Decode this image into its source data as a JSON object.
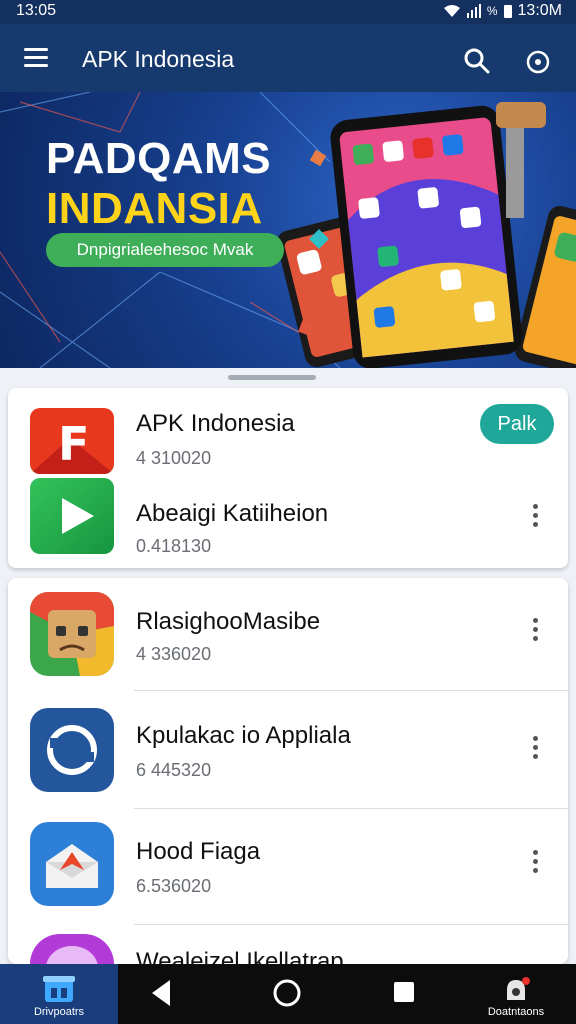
{
  "status_bar": {
    "time_left": "13:05",
    "battery": "%",
    "time_right": "13:0M"
  },
  "app_bar": {
    "title": "APK Indonesia"
  },
  "banner": {
    "headline_line1": "PADQAMS",
    "headline_line2": "INDANSIA",
    "pill_label": "Dnpigrialeehesoc Mvak"
  },
  "featured_card": {
    "action_button": "Palk",
    "apps": [
      {
        "name": "APK Indonesia",
        "meta": "4 310020"
      },
      {
        "name": "Abeaigi Katiiheion",
        "meta": "0.418130"
      }
    ]
  },
  "app_list": [
    {
      "name": "RlasighooMasibe",
      "meta": "4 336020"
    },
    {
      "name": "Kpulakac io Appliala",
      "meta": "6 445320"
    },
    {
      "name": "Hood Fiaga",
      "meta": "6.536020"
    },
    {
      "name": "Wealeizel Ikellatrap",
      "meta": ""
    }
  ],
  "bottom_nav": {
    "left_label": "Drivpoatrs",
    "right_label": "Doatntaons"
  },
  "colors": {
    "header": "#16396e",
    "accent_yellow": "#ffd31a",
    "accent_green": "#3fae58",
    "teal": "#1fa89a"
  }
}
